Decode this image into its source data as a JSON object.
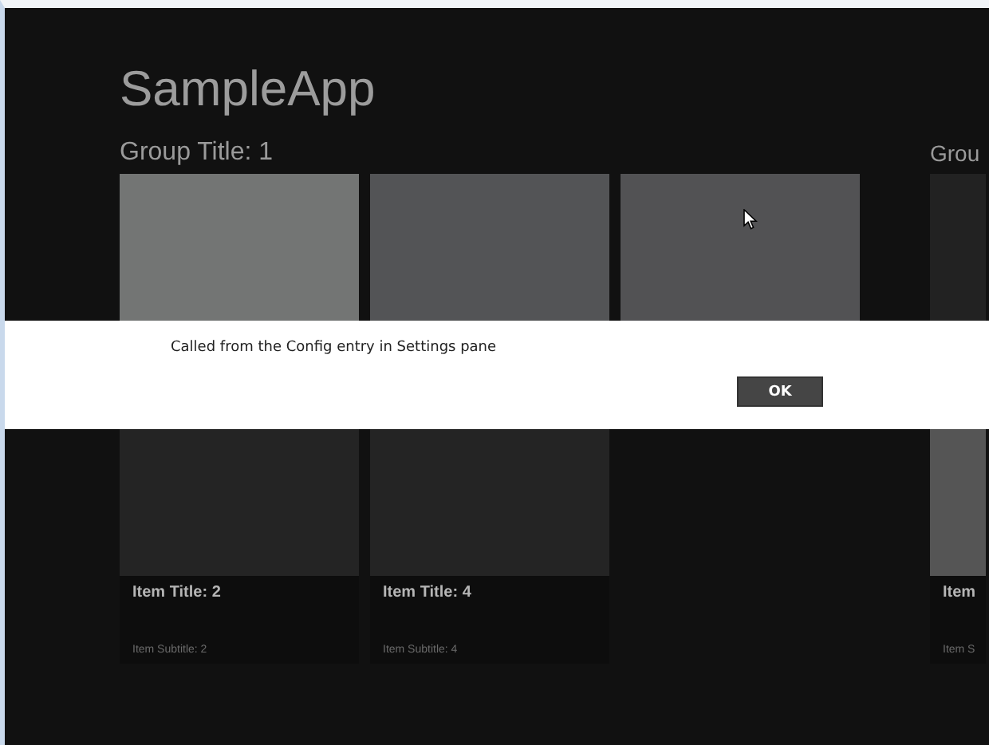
{
  "app_title": "SampleApp",
  "groups": [
    {
      "title": "Group Title: 1",
      "items": [
        {
          "color": "#737574"
        },
        {
          "color": "#242424",
          "title": "Item Title: 2",
          "subtitle": "Item Subtitle: 2"
        },
        {
          "color": "#535456"
        },
        {
          "color": "#242424",
          "title": "Item Title: 4",
          "subtitle": "Item Subtitle: 4"
        },
        {
          "color": "#525254"
        }
      ]
    },
    {
      "title": "Grou",
      "items": [
        {
          "color": "#222222"
        },
        {
          "color": "#555555",
          "title": "Item",
          "subtitle": "Item S"
        }
      ]
    }
  ],
  "dialog": {
    "message": "Called from the Config entry in Settings pane",
    "buttons": [
      "OK"
    ]
  }
}
